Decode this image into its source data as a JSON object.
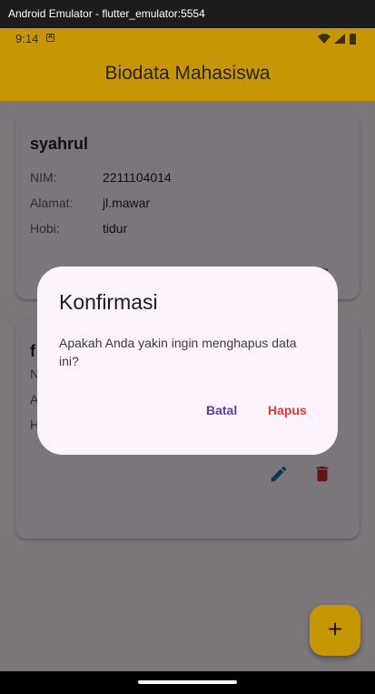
{
  "window": {
    "title": "Android Emulator - flutter_emulator:5554"
  },
  "status_bar": {
    "time": "9:14",
    "notification_icon": "a-box-icon",
    "icons": [
      "wifi-icon",
      "signal-icon",
      "battery-icon"
    ]
  },
  "app_bar": {
    "title": "Biodata Mahasiswa"
  },
  "labels": {
    "nim": "NIM:",
    "alamat": "Alamat:",
    "hobi": "Hobi:"
  },
  "students": [
    {
      "name": "syahrul",
      "nim": "2211104014",
      "alamat": "jl.mawar",
      "hobi": "tidur"
    },
    {
      "name": "f",
      "nim": "",
      "alamat": "",
      "hobi": ""
    }
  ],
  "card_actions": {
    "edit_icon": "pencil-icon",
    "delete_icon": "trash-icon",
    "edit_color": "#1a6ea8",
    "delete_color": "#c62828"
  },
  "fab": {
    "label": "+",
    "icon": "plus-icon"
  },
  "dialog": {
    "title": "Konfirmasi",
    "message": "Apakah Anda yakin ingin menghapus data ini?",
    "cancel_label": "Batal",
    "confirm_label": "Hapus",
    "cancel_color": "#5b3fa0",
    "confirm_color": "#e53935"
  },
  "colors": {
    "app_bar": "#c79605",
    "dialog_bg": "#fcf3fc",
    "scrim": "rgba(0,0,0,0.5)"
  }
}
